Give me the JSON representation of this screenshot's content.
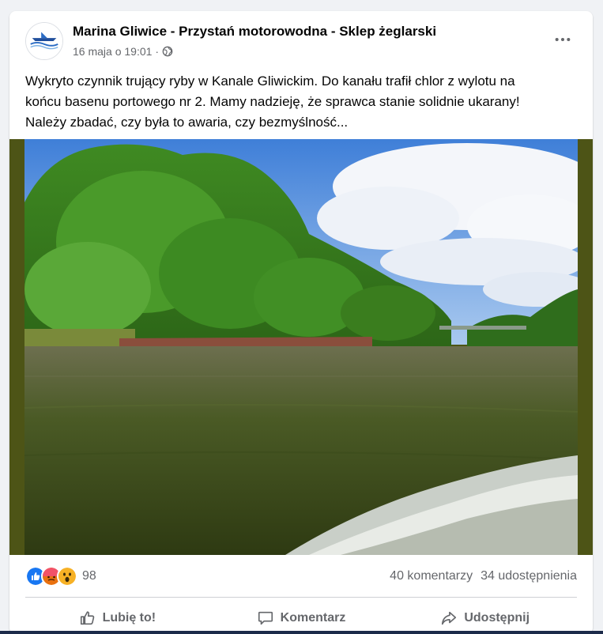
{
  "post": {
    "page_name": "Marina Gliwice - Przystań motorowodna - Sklep żeglarski",
    "date": "16 maja o 19:01",
    "separator": "·",
    "text_lines": [
      "Wykryto czynnik trujący ryby w Kanale Gliwickim. Do kanału trafił chlor z wylotu na",
      "końcu basenu portowego nr 2. Mamy nadzieję,  że sprawca stanie solidnie ukarany!",
      "Należy zbadać, czy była to awaria, czy bezmyślność..."
    ],
    "avatar_logo_text": "Marina Gliwice"
  },
  "stats": {
    "reactions_count": "98",
    "comments": "40 komentarzy",
    "shares": "34 udostępnienia",
    "reaction_icons": [
      "like-icon",
      "angry-icon",
      "wow-icon"
    ]
  },
  "actions": {
    "like": "Lubię to!",
    "comment": "Komentarz",
    "share": "Udostępnij"
  },
  "colors": {
    "like_blue": "#1877f2",
    "angry_orange": "#f25268",
    "wow_yellow": "#f7b125",
    "secondary_text": "#65676b"
  }
}
